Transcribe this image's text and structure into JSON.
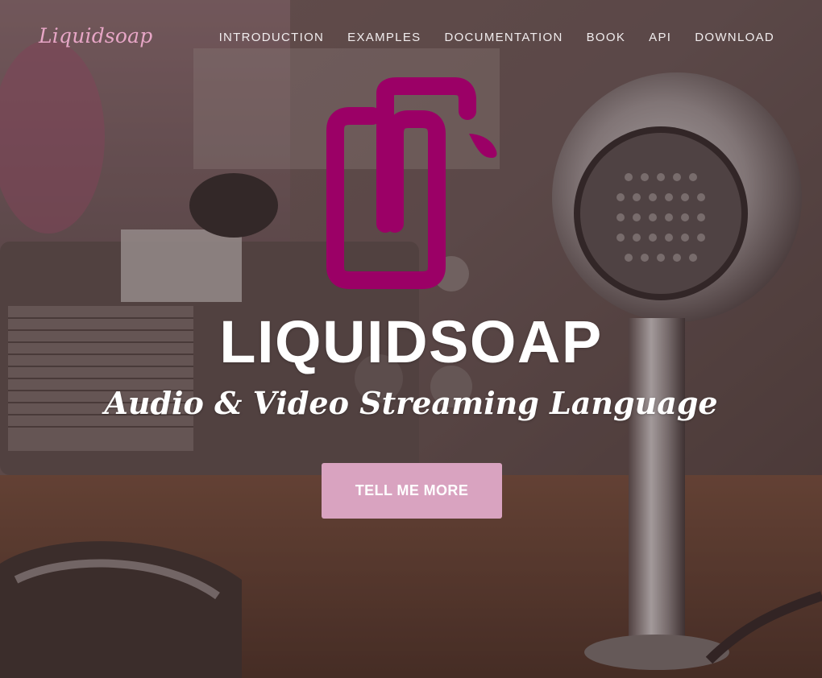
{
  "brand": {
    "name": "Liquidsoap"
  },
  "nav": {
    "items": [
      {
        "label": "INTRODUCTION"
      },
      {
        "label": "EXAMPLES"
      },
      {
        "label": "DOCUMENTATION"
      },
      {
        "label": "BOOK"
      },
      {
        "label": "API"
      },
      {
        "label": "DOWNLOAD"
      }
    ]
  },
  "hero": {
    "logo_icon": "liquidsoap-logo-icon",
    "title": "LIQUIDSOAP",
    "subtitle": "Audio & Video Streaming Language",
    "cta_label": "TELL ME MORE",
    "background_image": "vintage-microphone-and-radio-photo"
  },
  "colors": {
    "accent": "#9b0066",
    "brand_text": "#e7a6c6",
    "cta_background": "#d9a3c0",
    "overlay": "#26181a"
  }
}
